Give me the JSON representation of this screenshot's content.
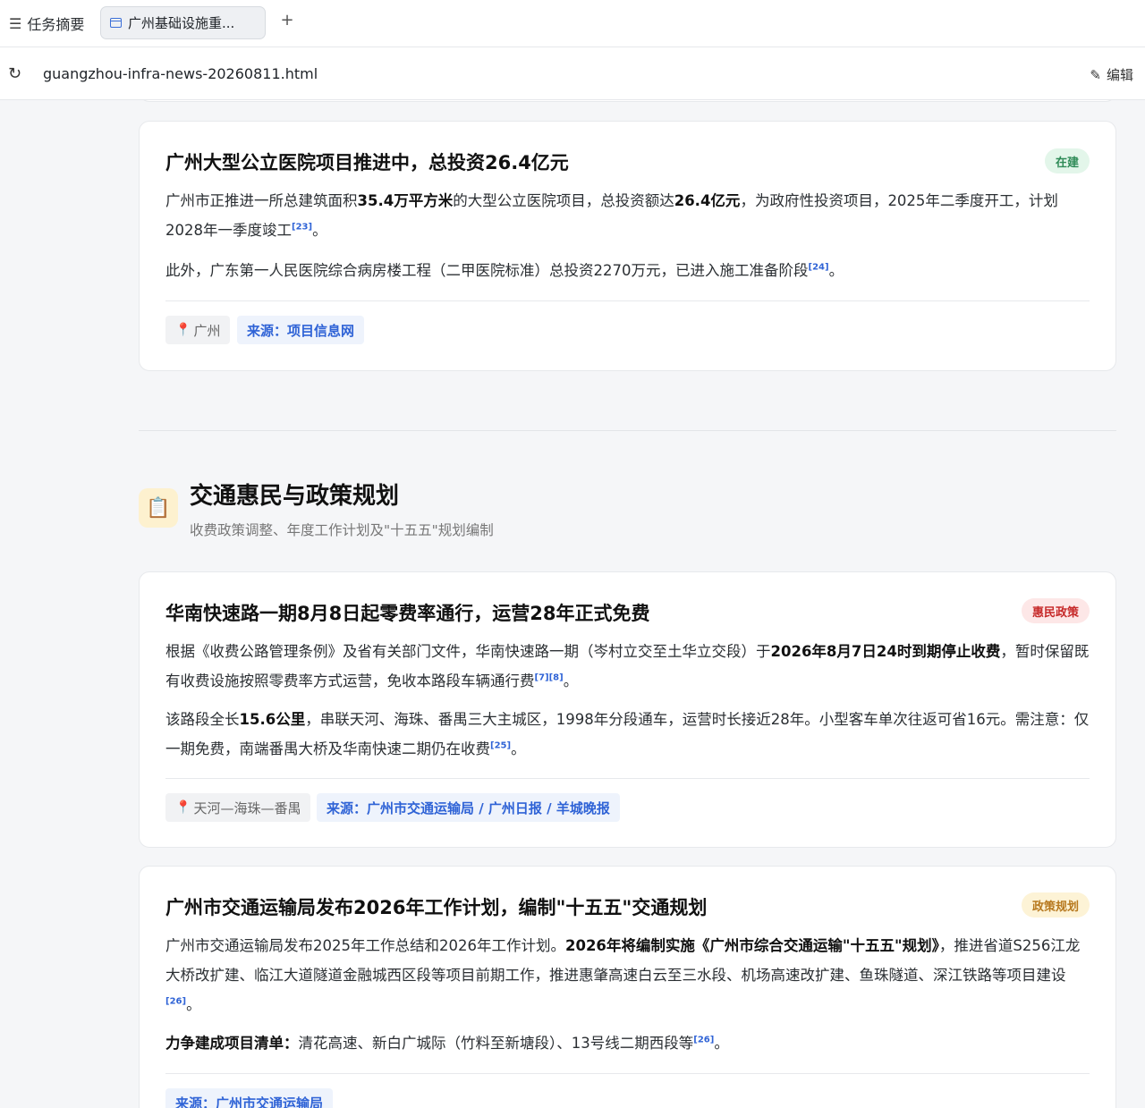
{
  "tabbar": {
    "task_summary": "任务摘要",
    "active_tab": "广州基础设施重...",
    "new_tab": "+"
  },
  "addrbar": {
    "url": "guangzhou-infra-news-20260811.html",
    "edit": "编辑"
  },
  "card1": {
    "title": "广州大型公立医院项目推进中，总投资26.4亿元",
    "badge": "在建",
    "p1": [
      "广州市正推进一所总建筑面积",
      "35.4万平方米",
      "的大型公立医院项目，总投资额达",
      "26.4亿元",
      "，为政府性投资项目，2025年二季度开工，计划2028年一季度竣工",
      "[23]",
      "。"
    ],
    "p2": [
      "此外，广东第一人民医院综合病房楼工程（二甲医院标准）总投资2270万元，已进入施工准备阶段",
      "[24]",
      "。"
    ],
    "tag_location": "广州",
    "tag_source": "来源：项目信息网"
  },
  "section": {
    "icon": "clipboard-icon",
    "title": "交通惠民与政策规划",
    "subtitle": "收费政策调整、年度工作计划及\"十五五\"规划编制"
  },
  "card2": {
    "title": "华南快速路一期8月8日起零费率通行，运营28年正式免费",
    "badge": "惠民政策",
    "p1": [
      "根据《收费公路管理条例》及省有关部门文件，华南快速路一期（岑村立交至土华立交段）于",
      "2026年8月7日24时到期停止收费",
      "，暂时保留既有收费设施按照零费率方式运营，免收本路段车辆通行费",
      "[7][8]",
      "。"
    ],
    "p2": [
      "该路段全长",
      "15.6公里",
      "，串联天河、海珠、番禺三大主城区，1998年分段通车，运营时长接近28年。小型客车单次往返可省16元。需注意：仅一期免费，南端番禺大桥及华南快速二期仍在收费",
      "[25]",
      "。"
    ],
    "tag_location": "天河—海珠—番禺",
    "tag_source": "来源：广州市交通运输局 / 广州日报 / 羊城晚报"
  },
  "card3": {
    "title": "广州市交通运输局发布2026年工作计划，编制\"十五五\"交通规划",
    "badge": "政策规划",
    "p1": [
      "广州市交通运输局发布2025年工作总结和2026年工作计划。",
      "2026年将编制实施《广州市综合交通运输\"十五五\"规划》",
      "，推进省道S256江龙大桥改扩建、临江大道隧道金融城西区段等项目前期工作，推进惠肇高速白云至三水段、机场高速改扩建、鱼珠隧道、深江铁路等项目建设",
      "[26]",
      "。"
    ],
    "p2": [
      "力争建成项目清单：",
      "清花高速、新白广城际（竹料至新塘段）、13号线二期西段等",
      "[26]",
      "。"
    ],
    "tag_source": "来源：广州市交通运输局"
  },
  "colors": {
    "accent_blue": "#2f63d6",
    "badge_green": "#2e8b57",
    "badge_red": "#c62828",
    "badge_yellow": "#b7791f"
  }
}
